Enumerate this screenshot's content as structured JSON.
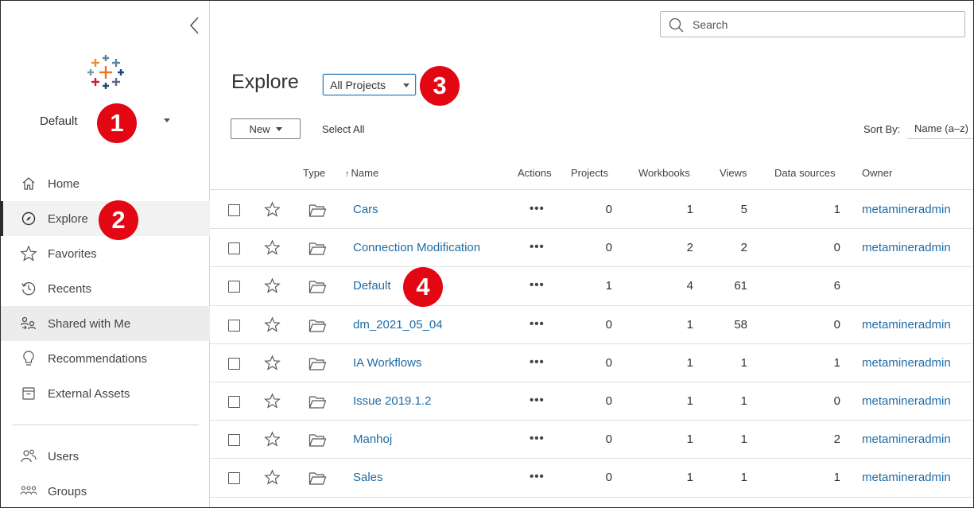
{
  "sidebar": {
    "site_name": "Default",
    "nav": [
      {
        "label": "Home",
        "icon": "home-icon"
      },
      {
        "label": "Explore",
        "icon": "compass-icon"
      },
      {
        "label": "Favorites",
        "icon": "star-icon"
      },
      {
        "label": "Recents",
        "icon": "clock-icon"
      },
      {
        "label": "Shared with Me",
        "icon": "shared-users-icon"
      },
      {
        "label": "Recommendations",
        "icon": "lightbulb-icon"
      },
      {
        "label": "External Assets",
        "icon": "archive-icon"
      }
    ],
    "nav2": [
      {
        "label": "Users",
        "icon": "users-icon"
      },
      {
        "label": "Groups",
        "icon": "groups-icon"
      }
    ]
  },
  "badges": {
    "b1": "1",
    "b2": "2",
    "b3": "3",
    "b4": "4"
  },
  "search": {
    "placeholder": "Search"
  },
  "main": {
    "title": "Explore",
    "project_filter": "All Projects",
    "new_label": "New",
    "select_all_label": "Select All",
    "sort_by_label": "Sort By:",
    "sort_value": "Name (a–z)"
  },
  "table": {
    "headers": {
      "type": "Type",
      "name": "Name",
      "sort_arrow": "↑",
      "actions": "Actions",
      "projects": "Projects",
      "workbooks": "Workbooks",
      "views": "Views",
      "data_sources": "Data sources",
      "owner": "Owner"
    },
    "actions_glyph": "•••",
    "rows": [
      {
        "name": "Cars",
        "projects": "0",
        "workbooks": "1",
        "views": "5",
        "data_sources": "1",
        "owner": "metamineradmin"
      },
      {
        "name": "Connection Modification",
        "projects": "0",
        "workbooks": "2",
        "views": "2",
        "data_sources": "0",
        "owner": "metamineradmin"
      },
      {
        "name": "Default",
        "projects": "1",
        "workbooks": "4",
        "views": "61",
        "data_sources": "6",
        "owner": ""
      },
      {
        "name": "dm_2021_05_04",
        "projects": "0",
        "workbooks": "1",
        "views": "58",
        "data_sources": "0",
        "owner": "metamineradmin"
      },
      {
        "name": "IA Workflows",
        "projects": "0",
        "workbooks": "1",
        "views": "1",
        "data_sources": "1",
        "owner": "metamineradmin"
      },
      {
        "name": "Issue 2019.1.2",
        "projects": "0",
        "workbooks": "1",
        "views": "1",
        "data_sources": "0",
        "owner": "metamineradmin"
      },
      {
        "name": "Manhoj",
        "projects": "0",
        "workbooks": "1",
        "views": "1",
        "data_sources": "2",
        "owner": "metamineradmin"
      },
      {
        "name": "Sales",
        "projects": "0",
        "workbooks": "1",
        "views": "1",
        "data_sources": "1",
        "owner": "metamineradmin"
      }
    ]
  }
}
